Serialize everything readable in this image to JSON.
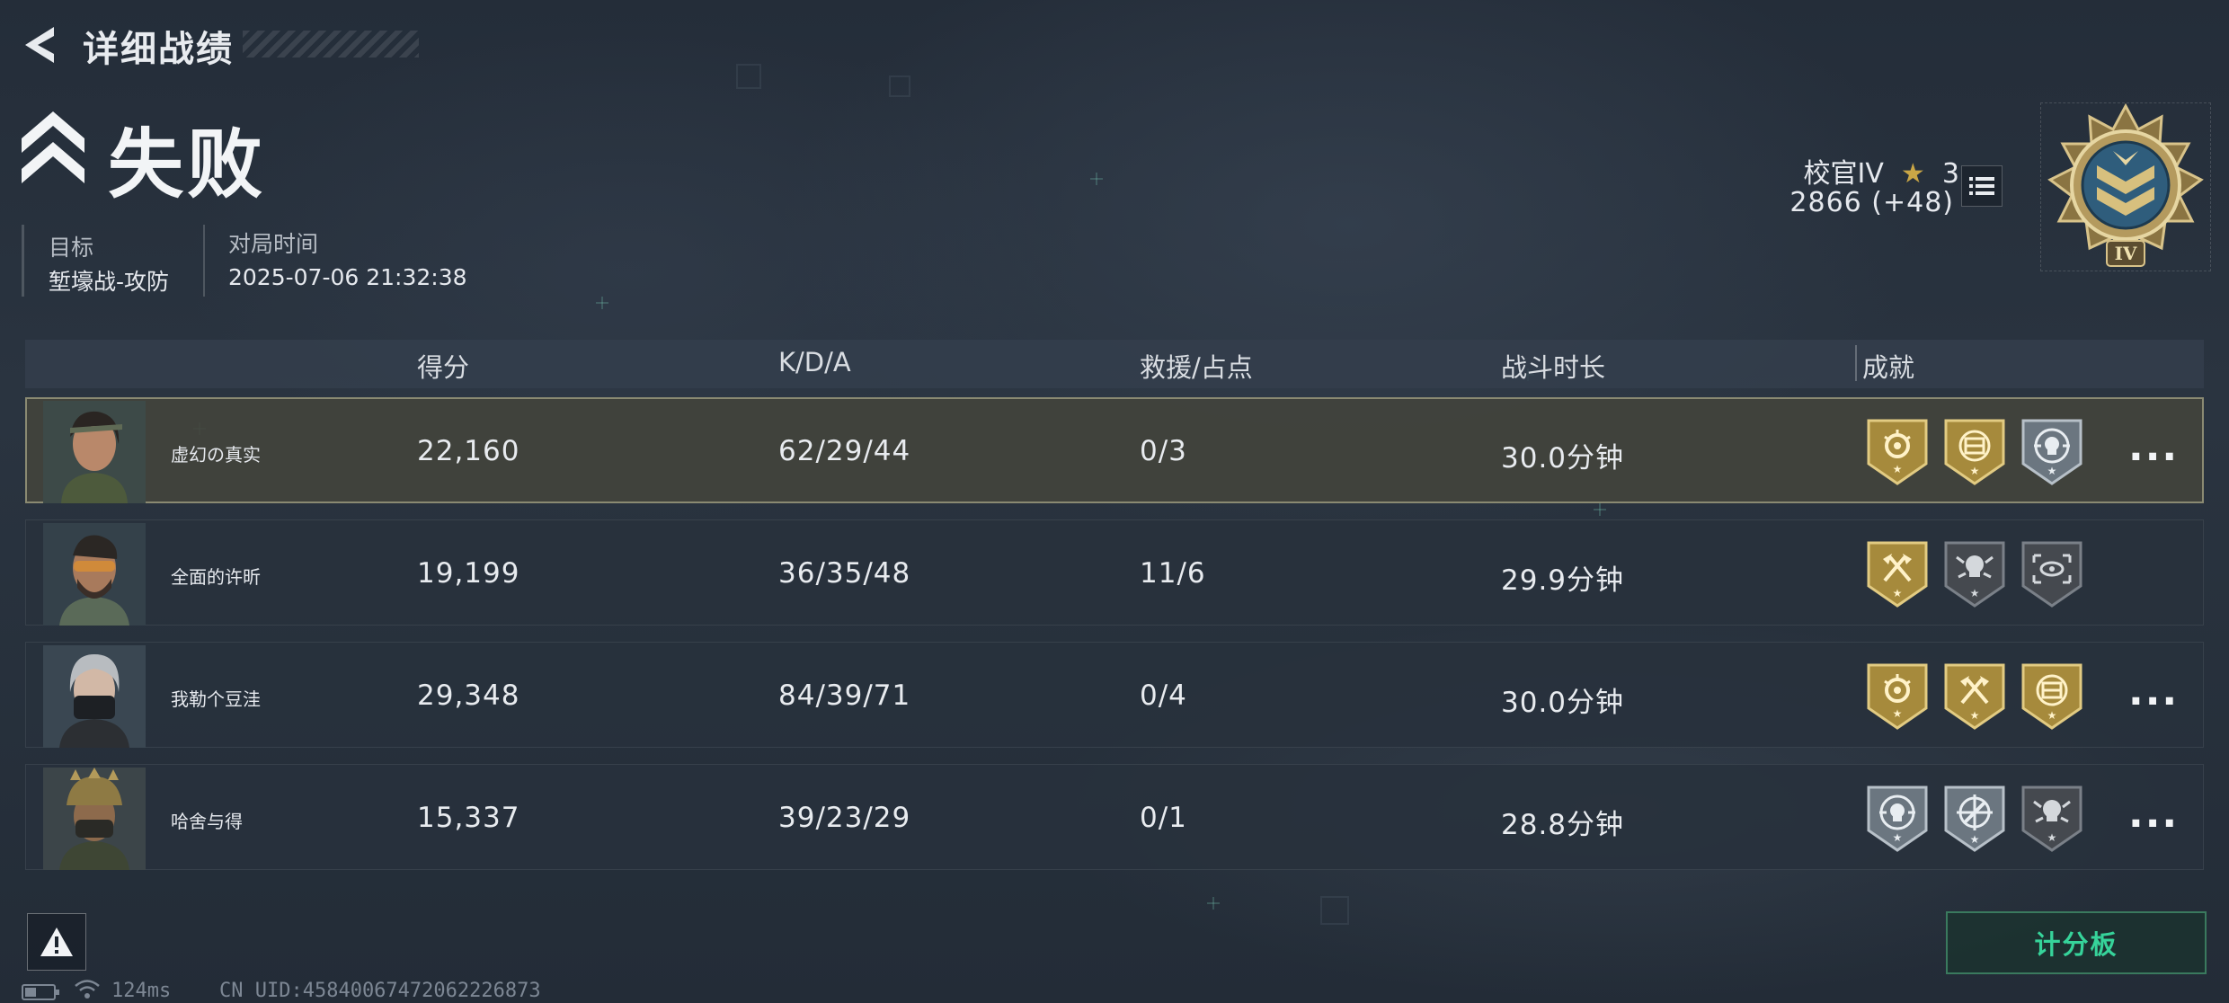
{
  "header": {
    "title": "详细战绩"
  },
  "result": {
    "text": "失败"
  },
  "match": {
    "target_label": "目标",
    "target_value": "堑壕战-攻防",
    "time_label": "对局时间",
    "time_value": "2025-07-06 21:32:38"
  },
  "rank": {
    "name": "校官IV",
    "stars": "3",
    "score": "2866 (+48)",
    "emblem_numeral": "IV"
  },
  "table": {
    "headers": [
      "得分",
      "K/D/A",
      "救援/占点",
      "战斗时长",
      "成就"
    ],
    "rows": [
      {
        "name": "虚幻の真实",
        "score": "22,160",
        "kda": "62/29/44",
        "rescue": "0/3",
        "duration": "30.0分钟",
        "badges": [
          "gold-rose-badge",
          "gold-crate-badge",
          "silver-skull-target-badge"
        ],
        "more": "..."
      },
      {
        "name": "全面的许昕",
        "score": "19,199",
        "kda": "36/35/48",
        "rescue": "11/6",
        "duration": "29.9分钟",
        "badges": [
          "gold-crossed-axes-badge",
          "grey-skull-badge",
          "grey-eye-scan-badge"
        ],
        "more": ""
      },
      {
        "name": "我勒个豆洼",
        "score": "29,348",
        "kda": "84/39/71",
        "rescue": "0/4",
        "duration": "30.0分钟",
        "badges": [
          "gold-rose-badge",
          "gold-crossed-axes-badge",
          "gold-crate-badge"
        ],
        "more": "..."
      },
      {
        "name": "哈舍与得",
        "score": "15,337",
        "kda": "39/23/29",
        "rescue": "0/1",
        "duration": "28.8分钟",
        "badges": [
          "silver-skull-target-badge",
          "silver-crosshair-badge",
          "grey-skull-badge"
        ],
        "more": "..."
      }
    ]
  },
  "footer": {
    "scoreboard_label": "计分板",
    "ping": "124ms",
    "uid": "CN UID:45840067472062226873"
  },
  "colors": {
    "gold": "#c9a646",
    "accent_green": "#36d39a",
    "highlight_border": "#8a8a72"
  }
}
